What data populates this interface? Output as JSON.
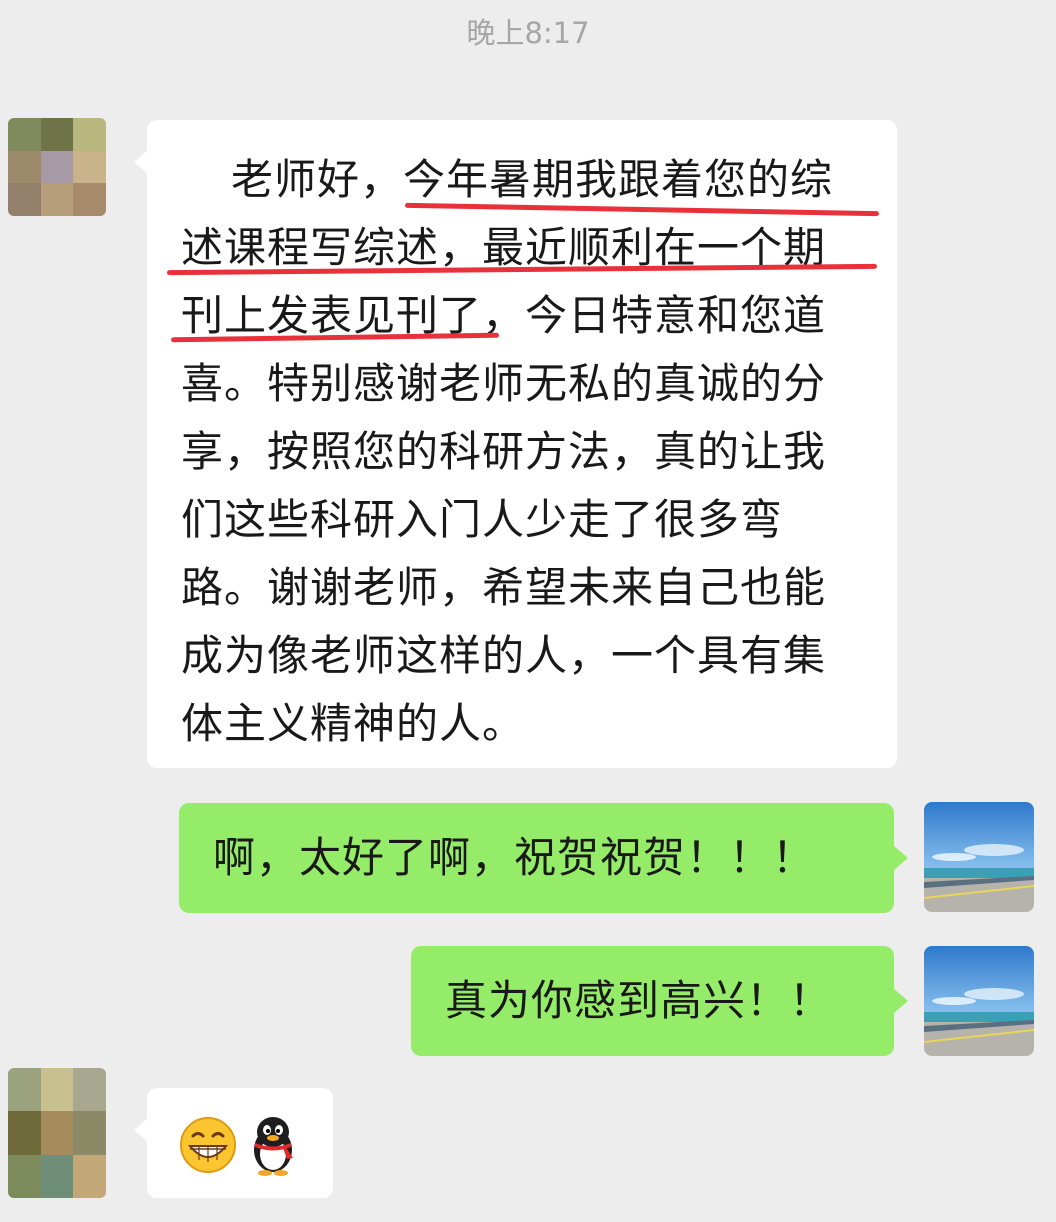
{
  "chat": {
    "timestamp": "晚上8:17",
    "messages": [
      {
        "side": "left",
        "lines": [
          "老师好，今年暑期我跟着您的综",
          "述课程写综述，最近顺利在一个期",
          "刊上发表见刊了，今日特意和您道",
          "喜。特别感谢老师无私的真诚的分",
          "享，按照您的科研方法，真的让我",
          "们这些科研入门人少走了很多弯",
          "路。谢谢老师，希望未来自己也能",
          "成为像老师这样的人，一个具有集",
          "体主义精神的人。"
        ]
      },
      {
        "side": "right",
        "text": "啊，太好了啊，祝贺祝贺！！！"
      },
      {
        "side": "right",
        "text": "真为你感到高兴！！"
      },
      {
        "side": "left",
        "emojis": [
          "grin-emoji",
          "qq-penguin-emoji"
        ]
      }
    ]
  },
  "colors": {
    "background": "#ededed",
    "left_bubble": "#ffffff",
    "right_bubble": "#95ec69",
    "underline": "#e8313a",
    "timestamp": "#a6a6a6"
  }
}
